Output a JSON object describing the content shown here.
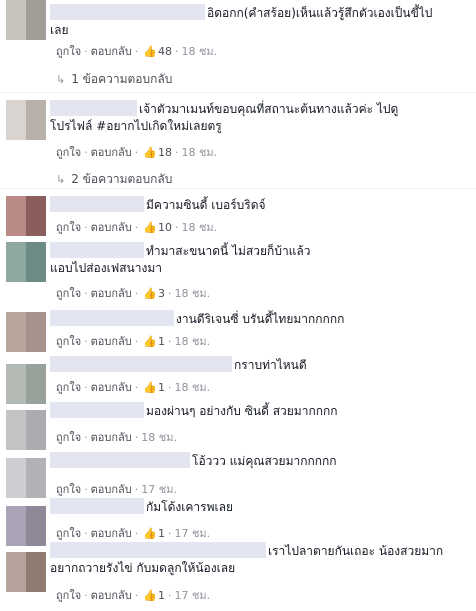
{
  "actions": {
    "like": "ถูกใจ",
    "reply": "ตอบกลับ",
    "dot": "·",
    "like_icon": "👍"
  },
  "colors": {
    "link": "#4b4f56",
    "meta": "#90949c",
    "like": "#5890ff",
    "name_redaction": "#e3e6f0"
  },
  "comments": [
    {
      "lines": [
        "อิดอกก(คำสร้อย)เห็นแล้วรู้สึกตัวเองเป็นขี้ไป",
        "เลย"
      ],
      "likes": "48",
      "time": "18 ชม.",
      "replies": "1 ข้อความตอบกลับ",
      "avatar": [
        "#c8c2bd",
        "#a39d98"
      ]
    },
    {
      "lines": [
        "เจ้าตัวมาเมนท์ขอบคุณที่สถานะต้นทางแล้วค่ะ ไปดู",
        "โปรไฟล์ #อยากไปเกิดใหม่เลยตรู"
      ],
      "likes": "18",
      "time": "18 ชม.",
      "replies": "2 ข้อความตอบกลับ",
      "avatar": [
        "#d9d4cf",
        "#b8b1a9"
      ]
    },
    {
      "lines": [
        "มีความซินดี้ เบอร์บริดจ์"
      ],
      "likes": "10",
      "time": "18 ชม.",
      "avatar": [
        "#b98a86",
        "#8b5d5c"
      ]
    },
    {
      "lines": [
        "ทำมาสะขนาดนี้ ไม่สวยก็บ้าแล้ว",
        "แอบไปส่องเฟสนางมา"
      ],
      "likes": "3",
      "time": "18 ชม.",
      "avatar": [
        "#8fa8a0",
        "#6c8a86"
      ]
    },
    {
      "lines": [
        "งานดีริเจนซี่ บรันดี้ไทยมากกกกก"
      ],
      "likes": "1",
      "time": "18 ชม.",
      "avatar": [
        "#b8a69c",
        "#a5938b"
      ]
    },
    {
      "lines": [
        "กราบท่าไหนดี"
      ],
      "likes": "1",
      "time": "18 ชม.",
      "avatar": [
        "#b3bab4",
        "#99a19b"
      ]
    },
    {
      "lines": [
        "มองผ่านๆ อย่างกับ ซินดี้ สวยมากกกก"
      ],
      "time": "18 ชม.",
      "avatar": [
        "#c6c3c7",
        "#adaab0"
      ]
    },
    {
      "lines": [
        "โอ้ววว แม่คุณสวยมากกกกก"
      ],
      "time": "17 ชม.",
      "avatar": [
        "#cfcdd2",
        "#b3b1b6"
      ]
    },
    {
      "lines": [
        "กัมโด้งเคารพเลย"
      ],
      "likes": "1",
      "time": "17 ชม.",
      "avatar": [
        "#a9a3b5",
        "#8e8899"
      ]
    },
    {
      "lines": [
        "เราไปลาตายกันเถอะ น้องสวยมาก",
        "อยากถวายรังไข่ กับมดลูกให้น้องเลย"
      ],
      "likes": "1",
      "time": "17 ชม.",
      "avatar": [
        "#b5a39b",
        "#8f7b72"
      ]
    }
  ]
}
